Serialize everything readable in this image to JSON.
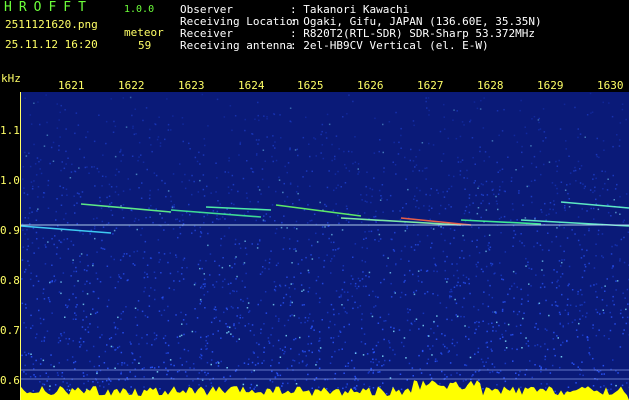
{
  "app": {
    "title": "HROFFT",
    "version": "1.0.0"
  },
  "file": {
    "name": "2511121620.png",
    "timestamp": "25.11.12 16:20"
  },
  "meteor": {
    "label": "meteor",
    "count": "59"
  },
  "info": [
    {
      "label": "Observer",
      "value": ": Takanori Kawachi"
    },
    {
      "label": "Receiving Location",
      "value": ": Ogaki, Gifu, JAPAN (136.60E, 35.35N)"
    },
    {
      "label": "Receiver",
      "value": ": R820T2(RTL-SDR) SDR-Sharp 53.372MHz"
    },
    {
      "label": "Receiving antenna",
      "value": ": 2el-HB9CV Vertical (el. E-W)"
    }
  ],
  "axes": {
    "unit": "kHz",
    "x_ticks": [
      "1621",
      "1622",
      "1623",
      "1624",
      "1625",
      "1626",
      "1627",
      "1628",
      "1629",
      "1630"
    ],
    "y_ticks": [
      "1.1",
      "1.0",
      "0.9",
      "0.8",
      "0.7",
      "0.6"
    ]
  },
  "colors": {
    "background": "#000000",
    "title": "#6cff3a",
    "axis": "#ffff66",
    "noise": "#1535c8",
    "echo": "#33ff66",
    "baseline": "#ffff00"
  }
}
